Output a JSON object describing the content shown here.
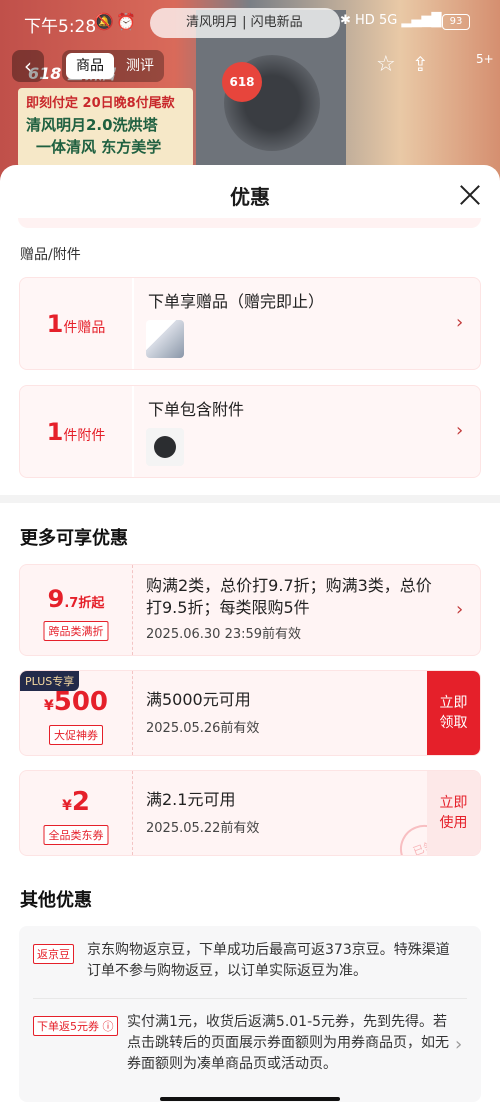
{
  "statusbar": {
    "time": "下午5:28",
    "bell_icon": "🔕",
    "alarm_icon": "⏰",
    "right_icons": "✱ HD 5G ▂▄▆█",
    "battery": "93",
    "search_text": "清风明月 | 闪电新品"
  },
  "background": {
    "badge": "618 全新启",
    "promo_line1": "即刻付定 20日晚8付尾款",
    "promo_line2": "清风明月2.0洗烘塔",
    "promo_line3": "一体清风 东方美学",
    "circle_618": "618"
  },
  "navbar": {
    "back": "‹",
    "tab_product": "商品",
    "tab_review": "测评",
    "star": "☆",
    "share": "⇪",
    "count": "5+"
  },
  "sheet": {
    "title": "优惠"
  },
  "gifts": {
    "section_label": "赠品/附件",
    "items": [
      {
        "num": "1",
        "unit": "件赠品",
        "text": "下单享赠品（赠完即止）"
      },
      {
        "num": "1",
        "unit": "件附件",
        "text": "下单包含附件"
      }
    ]
  },
  "more": {
    "title": "更多可享优惠",
    "coupons": [
      {
        "amount_big": "9",
        "amount_small": ".7折起",
        "tag": "跨品类满折",
        "main": "购满2类，总价打9.7折；购满3类，总价打9.5折；每类限购5件",
        "date": "2025.06.30 23:59前有效"
      },
      {
        "badge": "PLUS专享",
        "currency": "¥",
        "amount": "500",
        "tag": "大促神券",
        "main": "满5000元可用",
        "date": "2025.05.26前有效",
        "btn_line1": "立即",
        "btn_line2": "领取"
      },
      {
        "currency": "¥",
        "amount": "2",
        "tag": "全品类东券",
        "main": "满2.1元可用",
        "date": "2025.05.22前有效",
        "btn_line1": "立即",
        "btn_line2": "使用",
        "stamp": "已领"
      }
    ]
  },
  "other": {
    "title": "其他优惠",
    "items": [
      {
        "tag": "返京豆",
        "text": "京东购物返京豆，下单成功后最高可返373京豆。特殊渠道订单不参与购物返豆，以订单实际返豆为准。"
      },
      {
        "tag": "下单返5元券 ⓘ",
        "text": "实付满1元，收货后返满5.01-5元券，先到先得。若点击跳转后的页面展示券面额则为用券商品页，如无券面额则为凑单商品页或活动页。"
      }
    ]
  },
  "icons": {
    "chevron": "›"
  },
  "colors": {
    "accent_red": "#e5202a",
    "card_bg": "#fff4f4",
    "plus_badge_bg": "#232a4a"
  }
}
